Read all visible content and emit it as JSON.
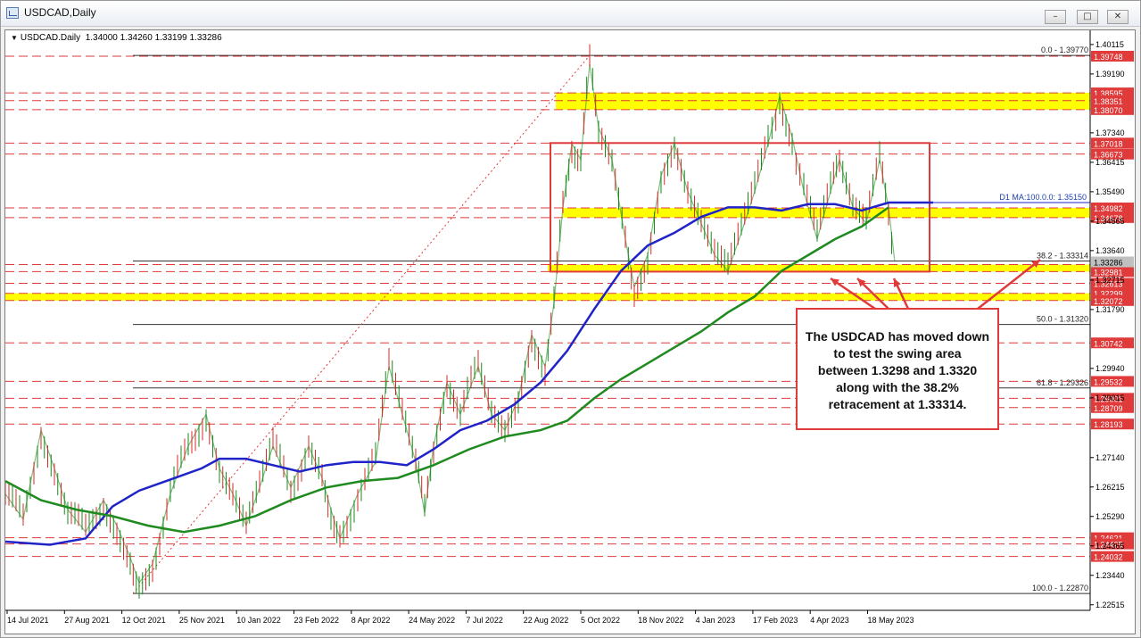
{
  "window": {
    "title": "USDCAD,Daily",
    "minimize_glyph": "–",
    "maximize_glyph": "□",
    "close_glyph": "✕"
  },
  "header": {
    "symbol": "USDCAD.Daily",
    "ohlc": "1.34000 1.34260 1.33199 1.33286"
  },
  "colors": {
    "candle_up": "#1a8a1a",
    "candle_down": "#d42a2a",
    "ma_blue": "#1f23c8",
    "ma_green": "#1f8a1f",
    "level_red": "#e03a3a",
    "highlight": "#ffff00"
  },
  "annotation": {
    "lines": [
      "The USDCAD has moved down",
      "to test the swing area",
      "between 1.3298 and 1.3320",
      "along with the 38.2%",
      "retracement at 1.33314."
    ]
  },
  "chart_data": {
    "type": "line",
    "title": "USDCAD,Daily",
    "ylim": [
      1.2234,
      1.4056
    ],
    "y_ticks": [
      "1.40115",
      "1.39190",
      "1.37340",
      "1.36415",
      "1.35490",
      "1.34565",
      "1.33640",
      "1.32715",
      "1.31790",
      "1.29940",
      "1.29015",
      "1.27140",
      "1.26215",
      "1.25290",
      "1.24365",
      "1.23440",
      "1.22515"
    ],
    "x_labels": [
      "14 Jul 2021",
      "27 Aug 2021",
      "12 Oct 2021",
      "25 Nov 2021",
      "10 Jan 2022",
      "23 Feb 2022",
      "8 Apr 2022",
      "24 May 2022",
      "7 Jul 2022",
      "22 Aug 2022",
      "5 Oct 2022",
      "18 Nov 2022",
      "4 Jan 2023",
      "17 Feb 2023",
      "4 Apr 2023",
      "18 May 2023"
    ],
    "price_levels": [
      {
        "value": 1.39748,
        "label": "1.39748"
      },
      {
        "value": 1.38595,
        "label": "1.38595"
      },
      {
        "value": 1.38351,
        "label": "1.38351"
      },
      {
        "value": 1.3807,
        "label": "1.38070"
      },
      {
        "value": 1.37018,
        "label": "1.37018"
      },
      {
        "value": 1.36673,
        "label": "1.36673"
      },
      {
        "value": 1.34982,
        "label": "1.34982"
      },
      {
        "value": 1.34678,
        "label": "1.34678"
      },
      {
        "value": 1.33203,
        "label": "1.33203"
      },
      {
        "value": 1.32981,
        "label": "1.32981"
      },
      {
        "value": 1.32613,
        "label": "1.32613"
      },
      {
        "value": 1.32299,
        "label": "1.32299"
      },
      {
        "value": 1.32072,
        "label": "1.32072"
      },
      {
        "value": 1.30742,
        "label": "1.30742"
      },
      {
        "value": 1.29532,
        "label": "1.29532"
      },
      {
        "value": 1.29001,
        "label": "1.29001"
      },
      {
        "value": 1.28709,
        "label": "1.28709"
      },
      {
        "value": 1.28193,
        "label": "1.28193"
      },
      {
        "value": 1.24621,
        "label": "1.24621"
      },
      {
        "value": 1.24425,
        "label": "1.24425"
      },
      {
        "value": 1.24032,
        "label": "1.24032"
      }
    ],
    "current_price": {
      "value": 1.33286,
      "label": "1.33286"
    },
    "fib_levels": [
      {
        "value": 1.3977,
        "label": "0.0 - 1.39770"
      },
      {
        "value": 1.33314,
        "label": "38.2 - 1.33314"
      },
      {
        "value": 1.3132,
        "label": "50.0 - 1.31320"
      },
      {
        "value": 1.29326,
        "label": "61.8 - 1.29326"
      },
      {
        "value": 1.2287,
        "label": "100.0 - 1.22870"
      }
    ],
    "ma_label": "D1 MA:100.0.0: 1.35150",
    "highlight_zones": [
      [
        1.3807,
        1.386
      ],
      [
        1.3468,
        1.3498
      ],
      [
        1.3298,
        1.332
      ],
      [
        1.3207,
        1.323
      ]
    ],
    "series": [
      {
        "name": "price",
        "points": [
          [
            0,
            1.26
          ],
          [
            20,
            1.252
          ],
          [
            40,
            1.28
          ],
          [
            55,
            1.268
          ],
          [
            70,
            1.255
          ],
          [
            90,
            1.248
          ],
          [
            110,
            1.258
          ],
          [
            125,
            1.25
          ],
          [
            140,
            1.24
          ],
          [
            150,
            1.232
          ],
          [
            165,
            1.238
          ],
          [
            185,
            1.26
          ],
          [
            205,
            1.275
          ],
          [
            225,
            1.285
          ],
          [
            240,
            1.268
          ],
          [
            255,
            1.26
          ],
          [
            270,
            1.25
          ],
          [
            285,
            1.262
          ],
          [
            300,
            1.275
          ],
          [
            320,
            1.262
          ],
          [
            340,
            1.275
          ],
          [
            355,
            1.265
          ],
          [
            365,
            1.255
          ],
          [
            375,
            1.246
          ],
          [
            395,
            1.26
          ],
          [
            415,
            1.27
          ],
          [
            430,
            1.3
          ],
          [
            445,
            1.285
          ],
          [
            460,
            1.27
          ],
          [
            470,
            1.254
          ],
          [
            480,
            1.275
          ],
          [
            495,
            1.295
          ],
          [
            510,
            1.285
          ],
          [
            530,
            1.3
          ],
          [
            545,
            1.285
          ],
          [
            560,
            1.28
          ],
          [
            575,
            1.29
          ],
          [
            590,
            1.31
          ],
          [
            605,
            1.3
          ],
          [
            615,
            1.32
          ],
          [
            625,
            1.35
          ],
          [
            635,
            1.37
          ],
          [
            645,
            1.365
          ],
          [
            655,
            1.395
          ],
          [
            665,
            1.375
          ],
          [
            680,
            1.365
          ],
          [
            695,
            1.34
          ],
          [
            705,
            1.325
          ],
          [
            720,
            1.335
          ],
          [
            735,
            1.36
          ],
          [
            750,
            1.37
          ],
          [
            765,
            1.355
          ],
          [
            780,
            1.345
          ],
          [
            795,
            1.335
          ],
          [
            810,
            1.33
          ],
          [
            825,
            1.342
          ],
          [
            840,
            1.355
          ],
          [
            855,
            1.37
          ],
          [
            868,
            1.385
          ],
          [
            882,
            1.372
          ],
          [
            895,
            1.355
          ],
          [
            910,
            1.34
          ],
          [
            925,
            1.355
          ],
          [
            935,
            1.365
          ],
          [
            950,
            1.35
          ],
          [
            965,
            1.345
          ],
          [
            980,
            1.365
          ],
          [
            990,
            1.35
          ],
          [
            997,
            1.3329
          ]
        ]
      },
      {
        "name": "ma-blue",
        "points": [
          [
            0,
            1.245
          ],
          [
            50,
            1.244
          ],
          [
            90,
            1.246
          ],
          [
            120,
            1.256
          ],
          [
            150,
            1.261
          ],
          [
            180,
            1.264
          ],
          [
            220,
            1.268
          ],
          [
            240,
            1.271
          ],
          [
            270,
            1.271
          ],
          [
            300,
            1.269
          ],
          [
            330,
            1.267
          ],
          [
            360,
            1.269
          ],
          [
            390,
            1.27
          ],
          [
            420,
            1.27
          ],
          [
            450,
            1.269
          ],
          [
            480,
            1.274
          ],
          [
            510,
            1.28
          ],
          [
            540,
            1.283
          ],
          [
            570,
            1.288
          ],
          [
            600,
            1.295
          ],
          [
            630,
            1.305
          ],
          [
            660,
            1.318
          ],
          [
            690,
            1.33
          ],
          [
            720,
            1.338
          ],
          [
            750,
            1.342
          ],
          [
            780,
            1.347
          ],
          [
            810,
            1.35
          ],
          [
            840,
            1.35
          ],
          [
            870,
            1.349
          ],
          [
            900,
            1.351
          ],
          [
            930,
            1.351
          ],
          [
            960,
            1.349
          ],
          [
            990,
            1.3515
          ],
          [
            1040,
            1.3515
          ]
        ]
      },
      {
        "name": "ma-green",
        "points": [
          [
            0,
            1.264
          ],
          [
            40,
            1.258
          ],
          [
            80,
            1.255
          ],
          [
            120,
            1.253
          ],
          [
            160,
            1.25
          ],
          [
            200,
            1.248
          ],
          [
            240,
            1.25
          ],
          [
            280,
            1.253
          ],
          [
            320,
            1.258
          ],
          [
            360,
            1.262
          ],
          [
            400,
            1.264
          ],
          [
            440,
            1.265
          ],
          [
            480,
            1.269
          ],
          [
            520,
            1.274
          ],
          [
            560,
            1.278
          ],
          [
            600,
            1.28
          ],
          [
            630,
            1.283
          ],
          [
            660,
            1.29
          ],
          [
            690,
            1.296
          ],
          [
            720,
            1.301
          ],
          [
            750,
            1.306
          ],
          [
            780,
            1.311
          ],
          [
            810,
            1.317
          ],
          [
            840,
            1.322
          ],
          [
            870,
            1.33
          ],
          [
            900,
            1.335
          ],
          [
            930,
            1.34
          ],
          [
            960,
            1.344
          ],
          [
            990,
            1.35
          ]
        ]
      }
    ]
  }
}
